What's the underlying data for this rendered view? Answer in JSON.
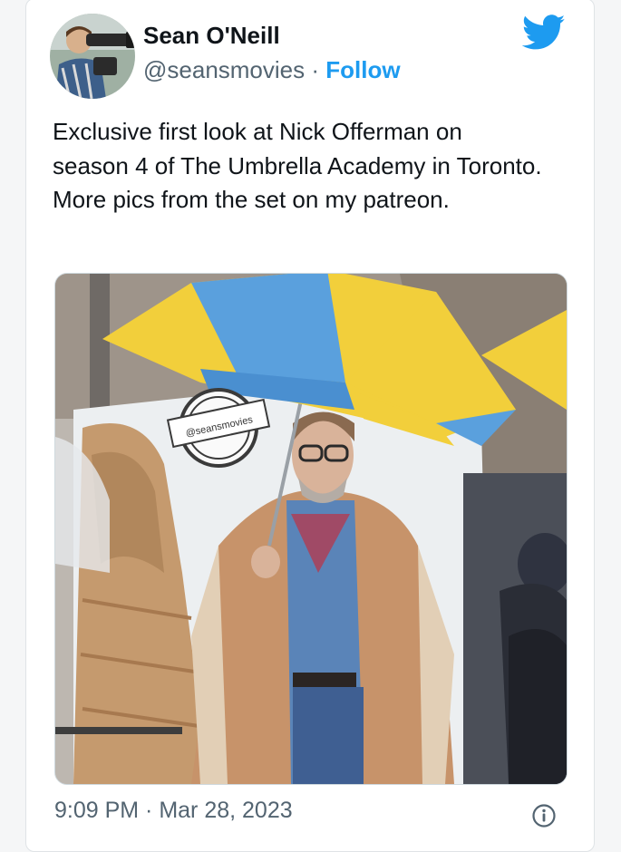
{
  "tweet": {
    "author_name": "Sean O'Neill",
    "handle": "@seansmovies",
    "separator": "·",
    "follow_label": "Follow",
    "text": "Exclusive first look at Nick Offerman on season 4 of The Umbrella Academy in Toronto. More pics from the set on my patreon.",
    "timestamp": "9:09 PM · Mar 28, 2023",
    "watermark": "@seansmovies"
  },
  "icons": {
    "brand": "twitter-bird-icon",
    "info": "info-icon"
  },
  "colors": {
    "accent": "#1d9bf0",
    "secondary_text": "#536471",
    "umbrella_yellow": "#f2cf3b",
    "umbrella_blue": "#5aa0dd"
  }
}
